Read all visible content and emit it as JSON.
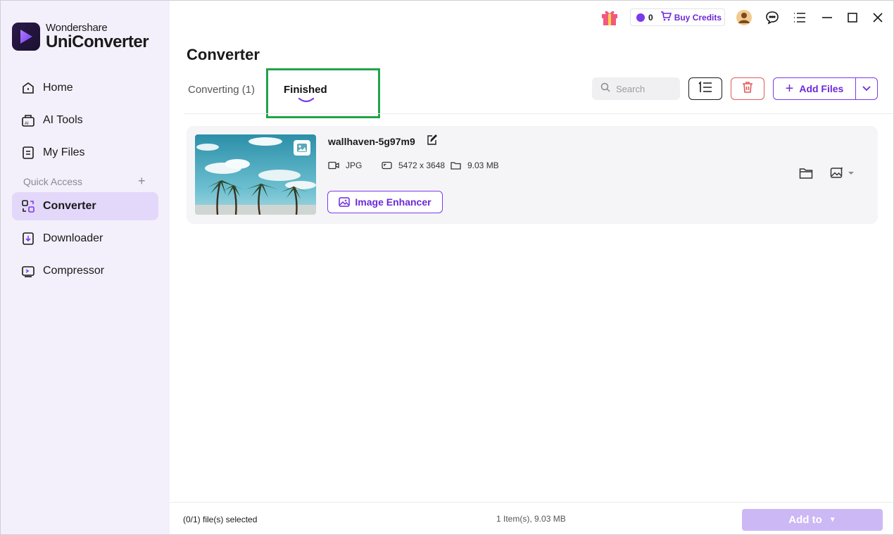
{
  "brand": {
    "company": "Wondershare",
    "product": "UniConverter"
  },
  "sidebar": {
    "items": [
      {
        "label": "Home",
        "icon": "home-icon"
      },
      {
        "label": "AI Tools",
        "icon": "ai-tools-icon"
      },
      {
        "label": "My Files",
        "icon": "my-files-icon"
      }
    ],
    "quick_access_label": "Quick Access",
    "quick_items": [
      {
        "label": "Converter",
        "icon": "converter-icon",
        "active": true
      },
      {
        "label": "Downloader",
        "icon": "downloader-icon"
      },
      {
        "label": "Compressor",
        "icon": "compressor-icon"
      }
    ]
  },
  "titlebar": {
    "credit_count": "0",
    "buy_credits": "Buy Credits"
  },
  "header": {
    "title": "Converter",
    "tabs": [
      {
        "label": "Converting (1)",
        "active": false
      },
      {
        "label": "Finished",
        "active": true
      }
    ],
    "search_placeholder": "Search",
    "add_files": "Add Files"
  },
  "files": [
    {
      "name": "wallhaven-5g97m9",
      "format": "JPG",
      "resolution": "5472 x 3648",
      "size": "9.03 MB",
      "action": "Image Enhancer"
    }
  ],
  "footer": {
    "selected": "(0/1) file(s) selected",
    "summary": "1 Item(s), 9.03 MB",
    "add_to": "Add to"
  },
  "colors": {
    "accent": "#7c3aed",
    "active_nav": "#e3d8fa",
    "sidebar_bg": "#f3f0fb",
    "highlight": "#22a34a"
  }
}
